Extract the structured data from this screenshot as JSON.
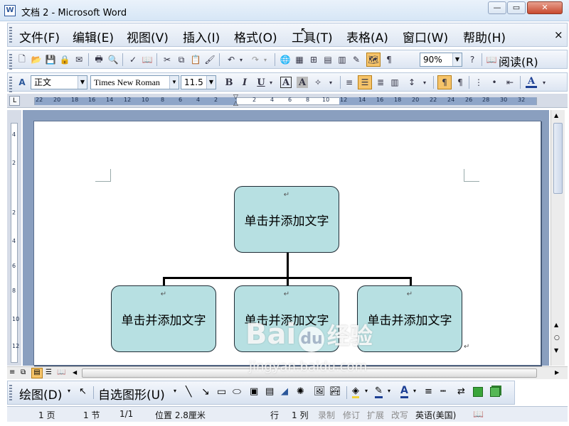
{
  "window": {
    "title": "文档 2 - Microsoft Word",
    "app_icon": "W"
  },
  "menu": {
    "items": [
      "文件(F)",
      "编辑(E)",
      "视图(V)",
      "插入(I)",
      "格式(O)",
      "工具(T)",
      "表格(A)",
      "窗口(W)",
      "帮助(H)"
    ],
    "close": "×"
  },
  "standard_toolbar": {
    "zoom": "90%",
    "read_label": "阅读(R)"
  },
  "format_toolbar": {
    "style": "正文",
    "font": "Times New Roman",
    "size": "11.5",
    "bold": "B",
    "italic": "I",
    "underline": "U",
    "char_border": "A",
    "char_shade": "A",
    "font_color": "A"
  },
  "ruler": {
    "left_ticks": [
      "22",
      "20",
      "18",
      "16",
      "14",
      "12",
      "10",
      "8",
      "6",
      "4",
      "2"
    ],
    "right_ticks": [
      "2",
      "4",
      "6",
      "8",
      "10",
      "12",
      "14",
      "16",
      "18",
      "20",
      "22",
      "24",
      "26",
      "28",
      "30",
      "32"
    ],
    "vticks": [
      "4",
      "2",
      "2",
      "4",
      "6",
      "8",
      "10",
      "12"
    ]
  },
  "diagram": {
    "root": "单击并添加文字",
    "children": [
      "单击并添加文字",
      "单击并添加文字",
      "单击并添加文字"
    ],
    "paragraph_mark": "↵"
  },
  "drawing_toolbar": {
    "draw": "绘图(D)",
    "autoshapes": "自选图形(U)"
  },
  "status": {
    "page": "1 页",
    "section": "1 节",
    "pages": "1/1",
    "position": "位置 2.8厘米",
    "line": "行",
    "col": "1 列",
    "rec": "录制",
    "trk": "修订",
    "ext": "扩展",
    "ovr": "改写",
    "language": "英语(美国)"
  },
  "watermark": {
    "logo": "Bai",
    "logo2": "du",
    "logo_suffix": "经验",
    "url": "jingyan.baidu.com"
  }
}
